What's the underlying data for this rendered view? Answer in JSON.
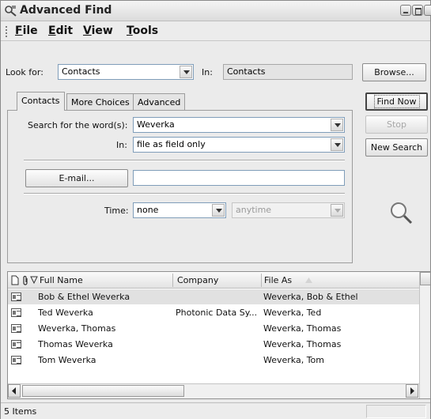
{
  "window": {
    "title": "Advanced Find"
  },
  "menu": [
    "File",
    "Edit",
    "View",
    "Tools"
  ],
  "lookfor": {
    "label": "Look for:",
    "value": "Contacts"
  },
  "in": {
    "label": "In:",
    "value": "Contacts"
  },
  "buttons": {
    "browse": "Browse...",
    "find_now": "Find Now",
    "stop": "Stop",
    "new_search": "New Search"
  },
  "tabs": [
    "Contacts",
    "More Choices",
    "Advanced"
  ],
  "form": {
    "search_label": "Search for the word(s):",
    "search_value": "Weverka",
    "in_label": "In:",
    "in_value": "file as field only",
    "email_button": "E-mail...",
    "email_value": "",
    "time_label": "Time:",
    "time_value": "none",
    "time_range": "anytime"
  },
  "grid": {
    "columns": [
      "Full Name",
      "Company",
      "File As"
    ],
    "rows": [
      {
        "full_name": "Bob & Ethel Weverka",
        "company": "",
        "file_as": "Weverka, Bob & Ethel",
        "selected": true
      },
      {
        "full_name": "Ted Weverka",
        "company": "Photonic Data Sy...",
        "file_as": "Weverka, Ted",
        "selected": false
      },
      {
        "full_name": "Weverka, Thomas",
        "company": "",
        "file_as": "Weverka, Thomas",
        "selected": false
      },
      {
        "full_name": "Thomas Weverka",
        "company": "",
        "file_as": "Weverka, Thomas",
        "selected": false
      },
      {
        "full_name": "Tom Weverka",
        "company": "",
        "file_as": "Weverka, Tom",
        "selected": false
      }
    ]
  },
  "status": {
    "text": "5 Items"
  }
}
